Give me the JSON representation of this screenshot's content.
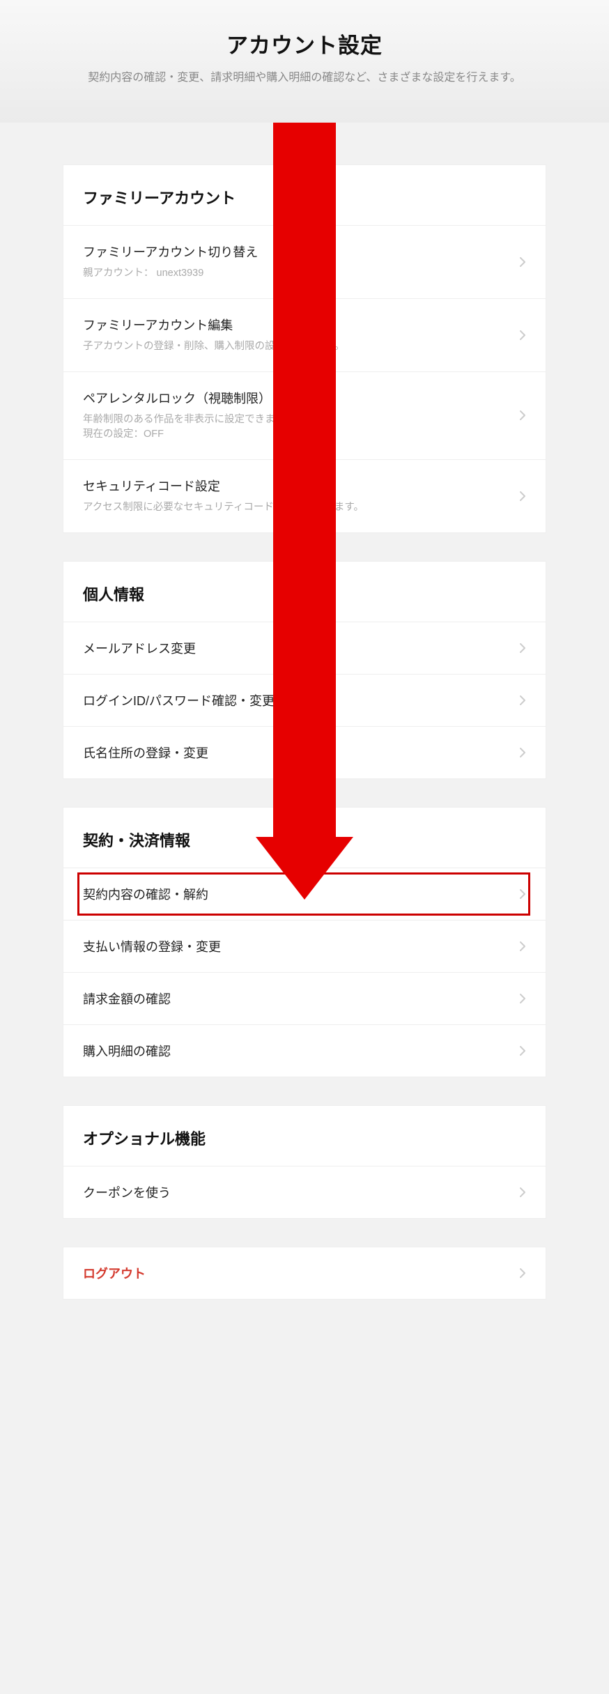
{
  "header": {
    "title": "アカウント設定",
    "subtitle": "契約内容の確認・変更、請求明細や購入明細の確認など、さまざまな設定を行えます。"
  },
  "sections": {
    "family": {
      "title": "ファミリーアカウント",
      "items": [
        {
          "title": "ファミリーアカウント切り替え",
          "desc_prefix": "親アカウント： ",
          "desc_value": "unext3939"
        },
        {
          "title": "ファミリーアカウント編集",
          "desc": "子アカウントの登録・削除、購入制限の設定ができます。"
        },
        {
          "title": "ペアレンタルロック（視聴制限）",
          "desc": "年齢制限のある作品を非表示に設定できます。\n現在の設定：OFF"
        },
        {
          "title": "セキュリティコード設定",
          "desc": "アクセス制限に必要なセキュリティコードの設定ができます。"
        }
      ]
    },
    "personal": {
      "title": "個人情報",
      "items": [
        {
          "title": "メールアドレス変更"
        },
        {
          "title": "ログインID/パスワード確認・変更"
        },
        {
          "title": "氏名住所の登録・変更"
        }
      ]
    },
    "contract": {
      "title": "契約・決済情報",
      "items": [
        {
          "title": "契約内容の確認・解約",
          "highlighted": true
        },
        {
          "title": "支払い情報の登録・変更"
        },
        {
          "title": "請求金額の確認"
        },
        {
          "title": "購入明細の確認"
        }
      ]
    },
    "optional": {
      "title": "オプショナル機能",
      "items": [
        {
          "title": "クーポンを使う"
        }
      ]
    },
    "logout": {
      "items": [
        {
          "title": "ログアウト",
          "logout": true
        }
      ]
    }
  }
}
